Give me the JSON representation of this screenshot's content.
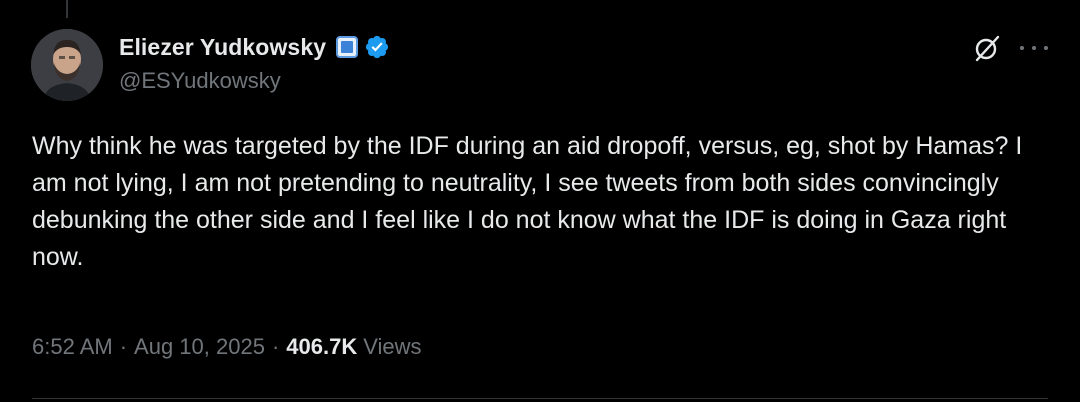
{
  "tweet": {
    "author": {
      "display_name": "Eliezer Yudkowsky",
      "handle": "@ESYudkowsky",
      "avatar_icon": "avatar-photo",
      "badge_icon": "blue-square-icon",
      "verified_icon": "verified-badge-icon"
    },
    "text": "Why think he was targeted by the IDF during an aid dropoff, versus, eg, shot by Hamas?  I am not lying, I am not pretending to neutrality, I see tweets from both sides convincingly debunking the other side and I feel like I do not know what the IDF is doing in Gaza right now.",
    "time": "6:52 AM",
    "separator": "·",
    "date": "Aug 10, 2025",
    "views_count": "406.7K",
    "views_label": "Views"
  },
  "actions": {
    "grok_icon": "grok-icon",
    "more_icon": "more-options-icon"
  },
  "colors": {
    "background": "#000000",
    "text_primary": "#e7e9ea",
    "text_secondary": "#71767b",
    "verified_blue": "#1d9bf0"
  }
}
